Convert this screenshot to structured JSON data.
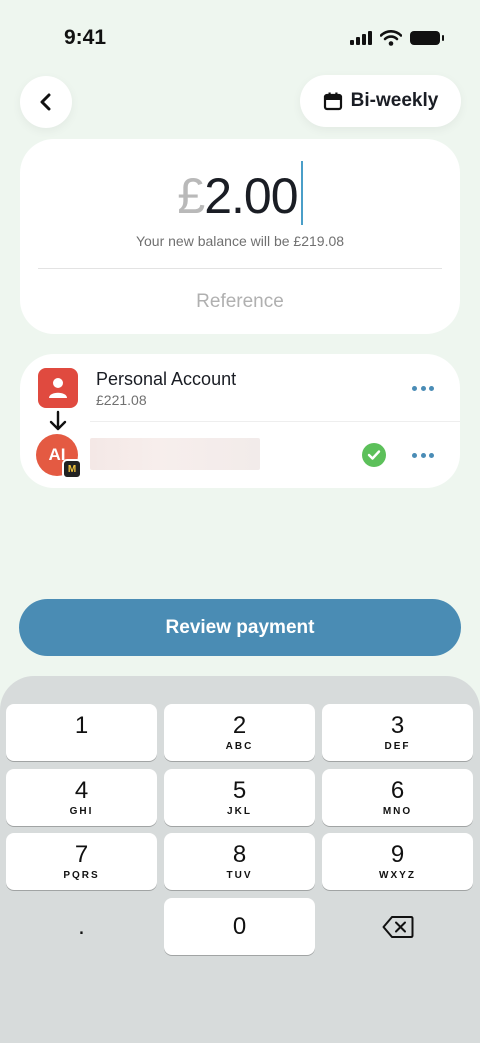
{
  "status_bar": {
    "time": "9:41"
  },
  "header": {
    "frequency_label": "Bi-weekly"
  },
  "amount": {
    "currency": "£",
    "value": "2.00",
    "balance_note": "Your new balance will be £219.08",
    "reference_placeholder": "Reference"
  },
  "from_account": {
    "name": "Personal Account",
    "balance": "£221.08"
  },
  "payee": {
    "initials": "AI",
    "bank_badge": "M"
  },
  "review_button": "Review payment",
  "keypad": {
    "keys": [
      {
        "digit": "1",
        "letters": ""
      },
      {
        "digit": "2",
        "letters": "ABC"
      },
      {
        "digit": "3",
        "letters": "DEF"
      },
      {
        "digit": "4",
        "letters": "GHI"
      },
      {
        "digit": "5",
        "letters": "JKL"
      },
      {
        "digit": "6",
        "letters": "MNO"
      },
      {
        "digit": "7",
        "letters": "PQRS"
      },
      {
        "digit": "8",
        "letters": "TUV"
      },
      {
        "digit": "9",
        "letters": "WXYZ"
      },
      {
        "digit": ".",
        "letters": ""
      },
      {
        "digit": "0",
        "letters": ""
      }
    ]
  },
  "colors": {
    "accent": "#4a8cb4",
    "background": "#eef6ef",
    "account_icon": "#e04a3f",
    "verified": "#5cc05a"
  }
}
